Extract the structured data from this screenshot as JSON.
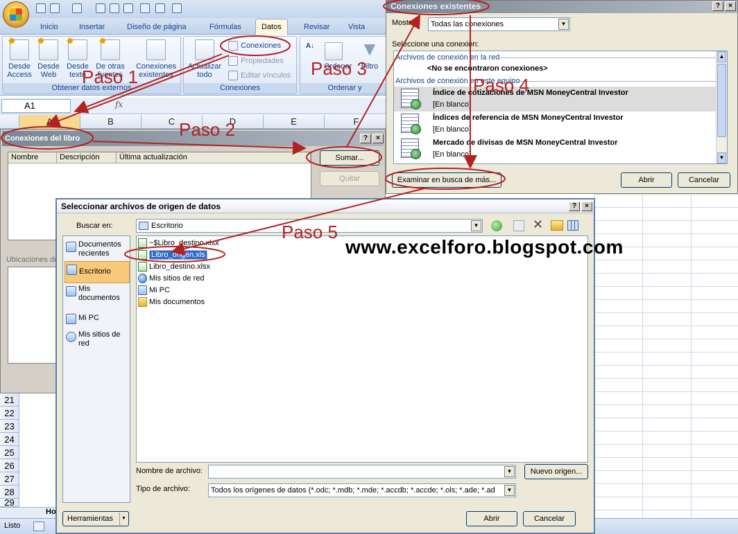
{
  "ribbon": {
    "tabs": [
      "Inicio",
      "Insertar",
      "Diseño de página",
      "Fórmulas",
      "Datos",
      "Revisar",
      "Vista"
    ],
    "active_tab": "Datos",
    "external_group": {
      "label": "Obtener datos externos",
      "buttons": [
        {
          "l1": "Desde",
          "l2": "Access"
        },
        {
          "l1": "Desde",
          "l2": "Web"
        },
        {
          "l1": "Desde",
          "l2": "texto"
        },
        {
          "l1": "De otras",
          "l2": "fuentes"
        }
      ],
      "existing": {
        "l1": "Conexiones",
        "l2": "existentes"
      }
    },
    "connections_group": {
      "label": "Conexiones",
      "refresh": {
        "l1": "Actualizar",
        "l2": "todo"
      },
      "conexiones": "Conexiones",
      "propiedades": "Propiedades",
      "editar": "Editar vínculos"
    },
    "sort_group": {
      "label": "Ordenar y",
      "sort_label": "Ordenar",
      "filter_label": "Filtro"
    }
  },
  "formula_bar": {
    "name_box": "A1",
    "fx": "fx"
  },
  "columns": [
    "A",
    "B",
    "C",
    "D",
    "E",
    "F"
  ],
  "libro_panel": {
    "title": "Conexiones del libro",
    "headers": [
      "Nombre",
      "Descripción",
      "Última actualización"
    ],
    "buttons": {
      "sumar": "Sumar...",
      "quitar": "Quitar"
    },
    "ubicaciones": "Ubicaciones do"
  },
  "rows": [
    "21",
    "22",
    "23",
    "24",
    "25",
    "26",
    "27",
    "28",
    "29"
  ],
  "status": {
    "ready": "Listo",
    "sheet_tab": "Ho"
  },
  "conex_dialog": {
    "title": "Conexiones existentes",
    "show_label": "Mostrar:",
    "show_value": "Todas las conexiones",
    "select_label": "Seleccione una conexión:",
    "section_network": "Archivos de conexión en la red",
    "no_connections": "<No se encontraron conexiones>",
    "section_local": "Archivos de conexión en este equipo",
    "items": [
      {
        "name": "Índice de cotizaciones de MSN MoneyCentral Investor",
        "desc": "[En blanco]"
      },
      {
        "name": "Índices de referencia de MSN MoneyCentral Investor",
        "desc": "[En blanco]"
      },
      {
        "name": "Mercado de divisas de MSN MoneyCentral Investor",
        "desc": "[En blanco]"
      }
    ],
    "browse": "Examinar en busca de más...",
    "open": "Abrir",
    "cancel": "Cancelar"
  },
  "files_dialog": {
    "title": "Seleccionar archivos de origen de datos",
    "lookin_label": "Buscar en:",
    "lookin_value": "Escritorio",
    "places": [
      {
        "l1": "Documentos",
        "l2": "recientes"
      },
      {
        "l1": "Escritorio",
        "l2": ""
      },
      {
        "l1": "Mis",
        "l2": "documentos"
      },
      {
        "l1": "Mi PC",
        "l2": ""
      },
      {
        "l1": "Mis sitios de",
        "l2": "red"
      }
    ],
    "files": [
      {
        "name": "~$Libro_destino.xlsx",
        "kind": "xls"
      },
      {
        "name": "Libro_origen.xls",
        "kind": "xls"
      },
      {
        "name": "Libro_destino.xlsx",
        "kind": "xls"
      },
      {
        "name": "Mis sitios de red",
        "kind": "net"
      },
      {
        "name": "Mi PC",
        "kind": "pc"
      },
      {
        "name": "Mis documentos",
        "kind": "folder"
      }
    ],
    "filename_label": "Nombre de archivo:",
    "filename_value": "",
    "filetype_label": "Tipo de archivo:",
    "filetype_value": "Todos los orígenes de datos (*.odc; *.mdb; *.mde; *.accdb; *.accde; *.ols; *.ade; *.ad",
    "new_source": "Nuevo origen...",
    "tools": "Herramientas",
    "open": "Abrir",
    "cancel": "Cancelar"
  },
  "annotations": {
    "paso1": "Paso 1",
    "paso2": "Paso 2",
    "paso3": "Paso 3",
    "paso4": "Paso 4",
    "paso5": "Paso 5",
    "watermark": "www.excelforo.blogspot.com"
  },
  "colors": {
    "annotation": "#b22222",
    "selection": "#316ac5",
    "ribbon_text": "#15428b"
  }
}
